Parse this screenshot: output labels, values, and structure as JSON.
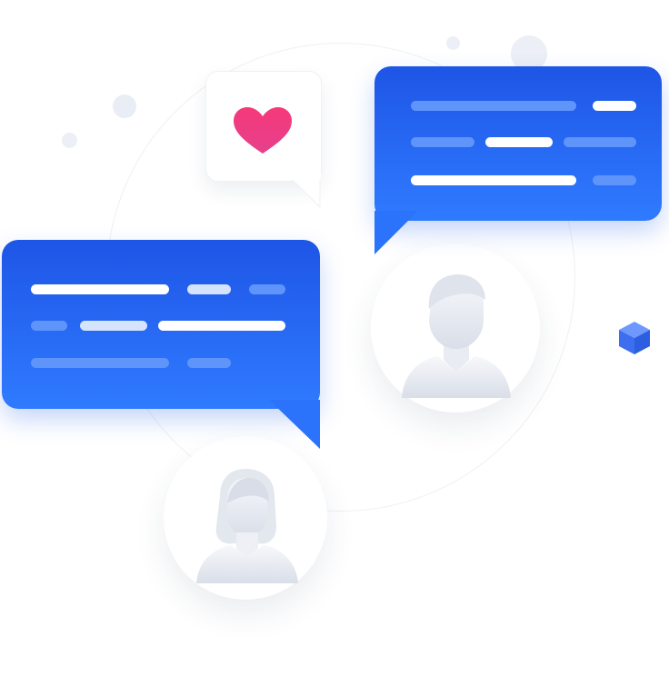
{
  "colors": {
    "bubble_top": "#1e55e6",
    "bubble_bottom": "#2f7bff",
    "heart": "#f0437f",
    "avatar_fill": "#dfe3ec",
    "cube": "#3d6ef0",
    "dots": "#e8ecf4"
  },
  "icons": {
    "heart": "heart-icon",
    "male_user": "male-user-icon",
    "female_user": "female-user-icon",
    "cube": "cube-icon"
  }
}
